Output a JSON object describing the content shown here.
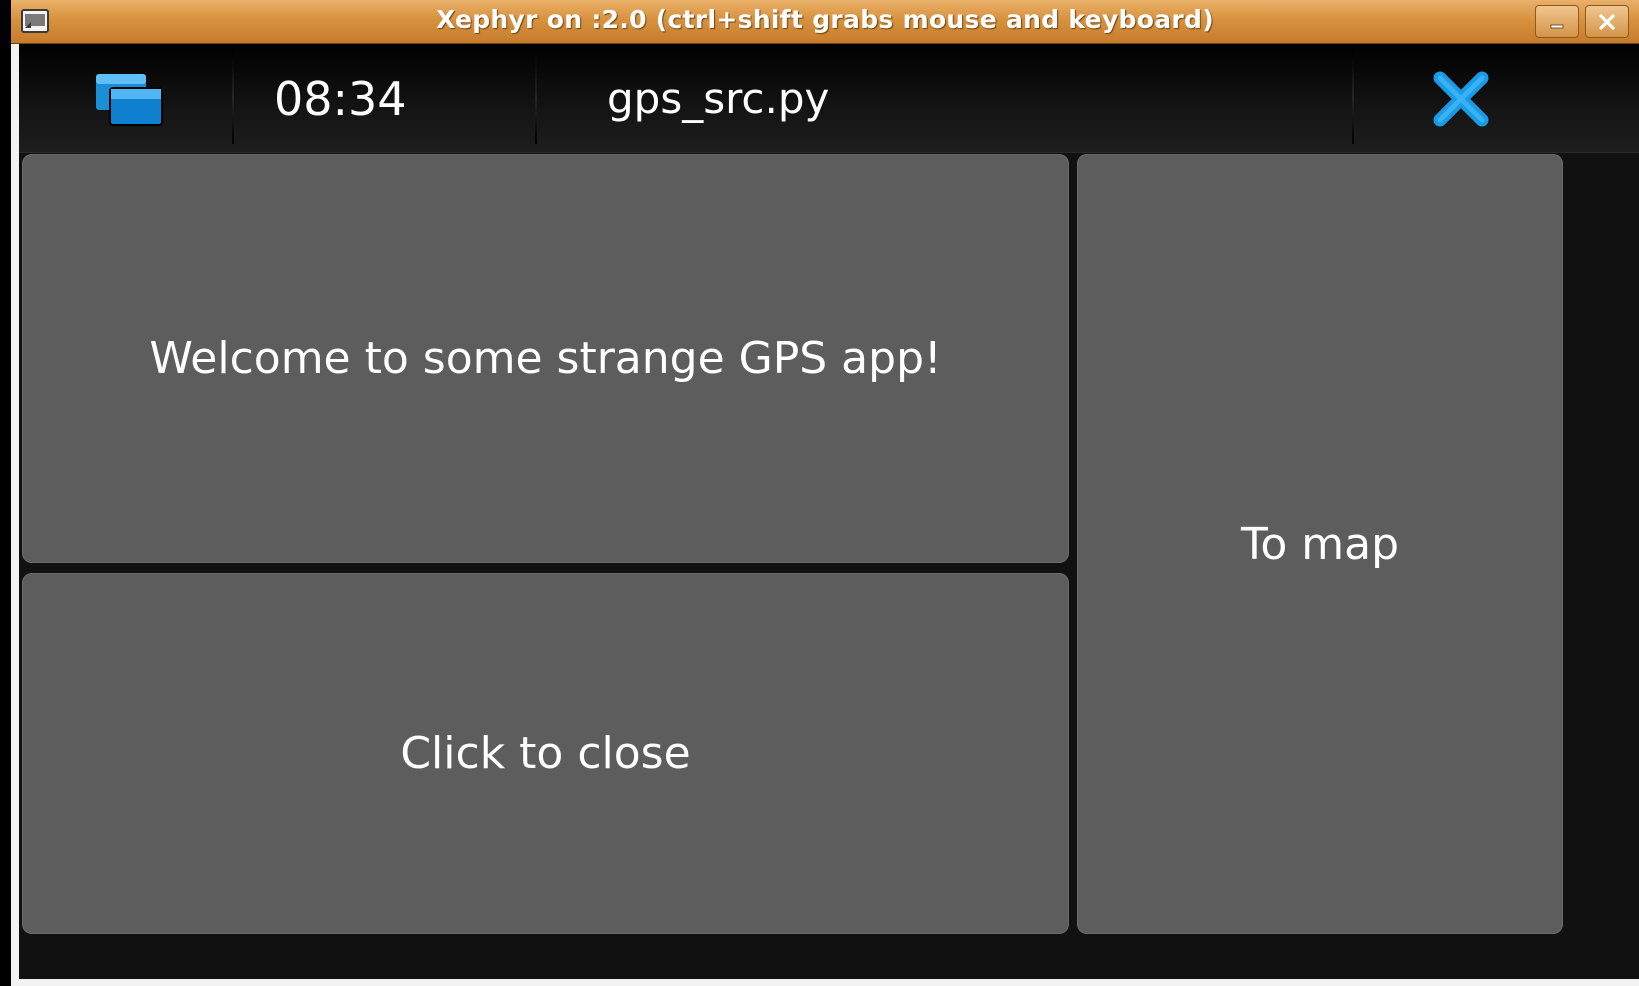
{
  "window": {
    "title": "Xephyr on :2.0 (ctrl+shift grabs mouse and keyboard)",
    "title_bar_color": "#d8923e"
  },
  "statusbar": {
    "switcher_icon": "task-switcher-icon",
    "clock": "08:34",
    "app_title": "gps_src.py",
    "close_icon": "close-icon",
    "accent": "#1a9be6"
  },
  "panels": {
    "welcome_text": "Welcome to some strange GPS app!",
    "close_label": "Click to close",
    "map_label": "To map",
    "panel_color": "#5d5d5d"
  }
}
